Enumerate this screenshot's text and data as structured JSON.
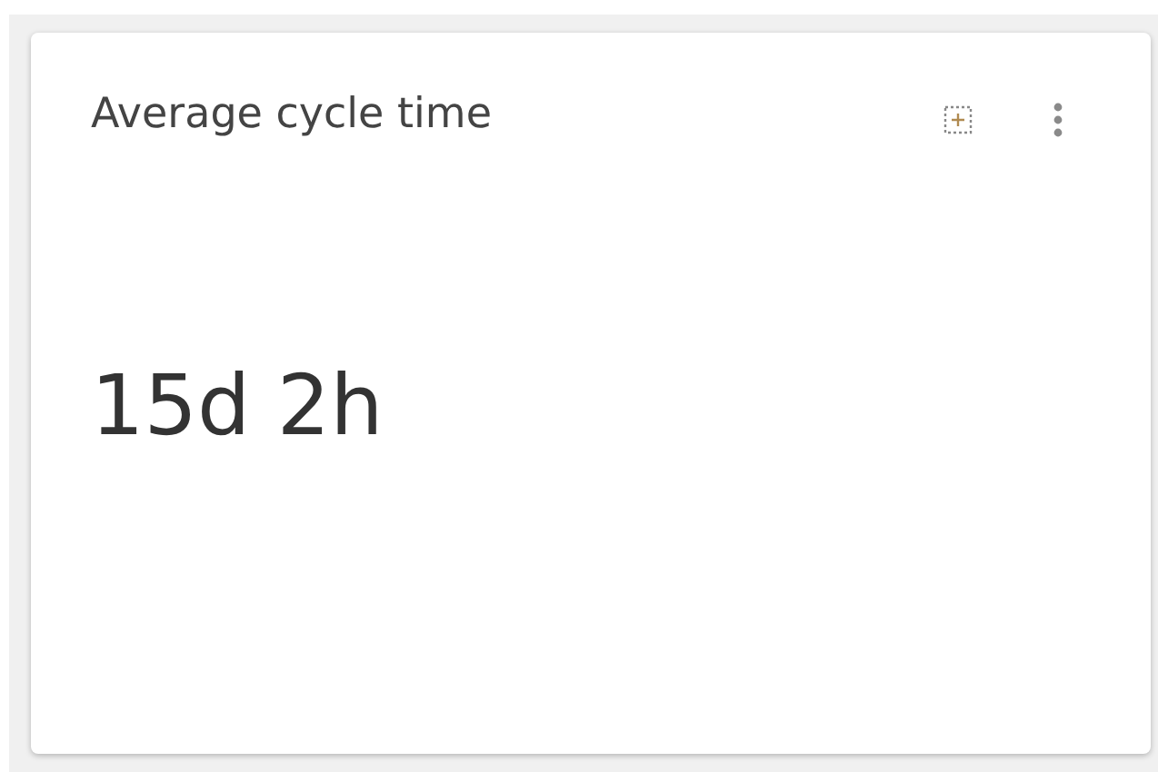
{
  "card": {
    "title": "Average cycle time",
    "value": "15d 2h"
  }
}
